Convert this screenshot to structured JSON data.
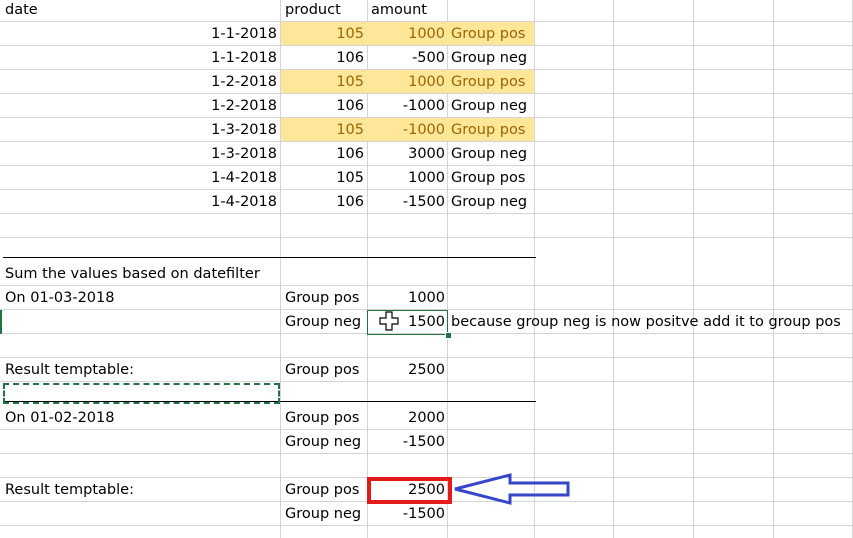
{
  "headers": {
    "date": "date",
    "product": "product",
    "amount": "amount"
  },
  "rows": [
    {
      "date": "1-1-2018",
      "product": "105",
      "amount": "1000",
      "group": "Group pos"
    },
    {
      "date": "1-1-2018",
      "product": "106",
      "amount": "-500",
      "group": "Group neg"
    },
    {
      "date": "1-2-2018",
      "product": "105",
      "amount": "1000",
      "group": "Group pos"
    },
    {
      "date": "1-2-2018",
      "product": "106",
      "amount": "-1000",
      "group": "Group neg"
    },
    {
      "date": "1-3-2018",
      "product": "105",
      "amount": "-1000",
      "group": "Group pos"
    },
    {
      "date": "1-3-2018",
      "product": "106",
      "amount": "3000",
      "group": "Group neg"
    },
    {
      "date": "1-4-2018",
      "product": "105",
      "amount": "1000",
      "group": "Group pos"
    },
    {
      "date": "1-4-2018",
      "product": "106",
      "amount": "-1500",
      "group": "Group neg"
    }
  ],
  "section": {
    "title": "Sum the values based on datefilter",
    "filter1": {
      "label": "On 01-03-2018",
      "pos_label": "Group pos",
      "pos_value": "1000",
      "neg_label": "Group neg",
      "neg_value": "1500",
      "note": "because group neg is now positve add it to group pos"
    },
    "result1": {
      "label": "Result temptable:",
      "group": "Group pos",
      "value": "2500"
    },
    "filter2": {
      "label": "On 01-02-2018",
      "pos_label": "Group pos",
      "pos_value": "2000",
      "neg_label": "Group neg",
      "neg_value": "-1500"
    },
    "result2": {
      "label": "Result temptable:",
      "pos_label": "Group pos",
      "pos_value": "2500",
      "neg_label": "Group neg",
      "neg_value": "-1500"
    }
  },
  "colors": {
    "highlight_fill": "#ffe699",
    "highlight_text": "#9c6500",
    "selection": "#217346",
    "annotation_box": "#e31b1b",
    "annotation_arrow": "#3546c8"
  }
}
